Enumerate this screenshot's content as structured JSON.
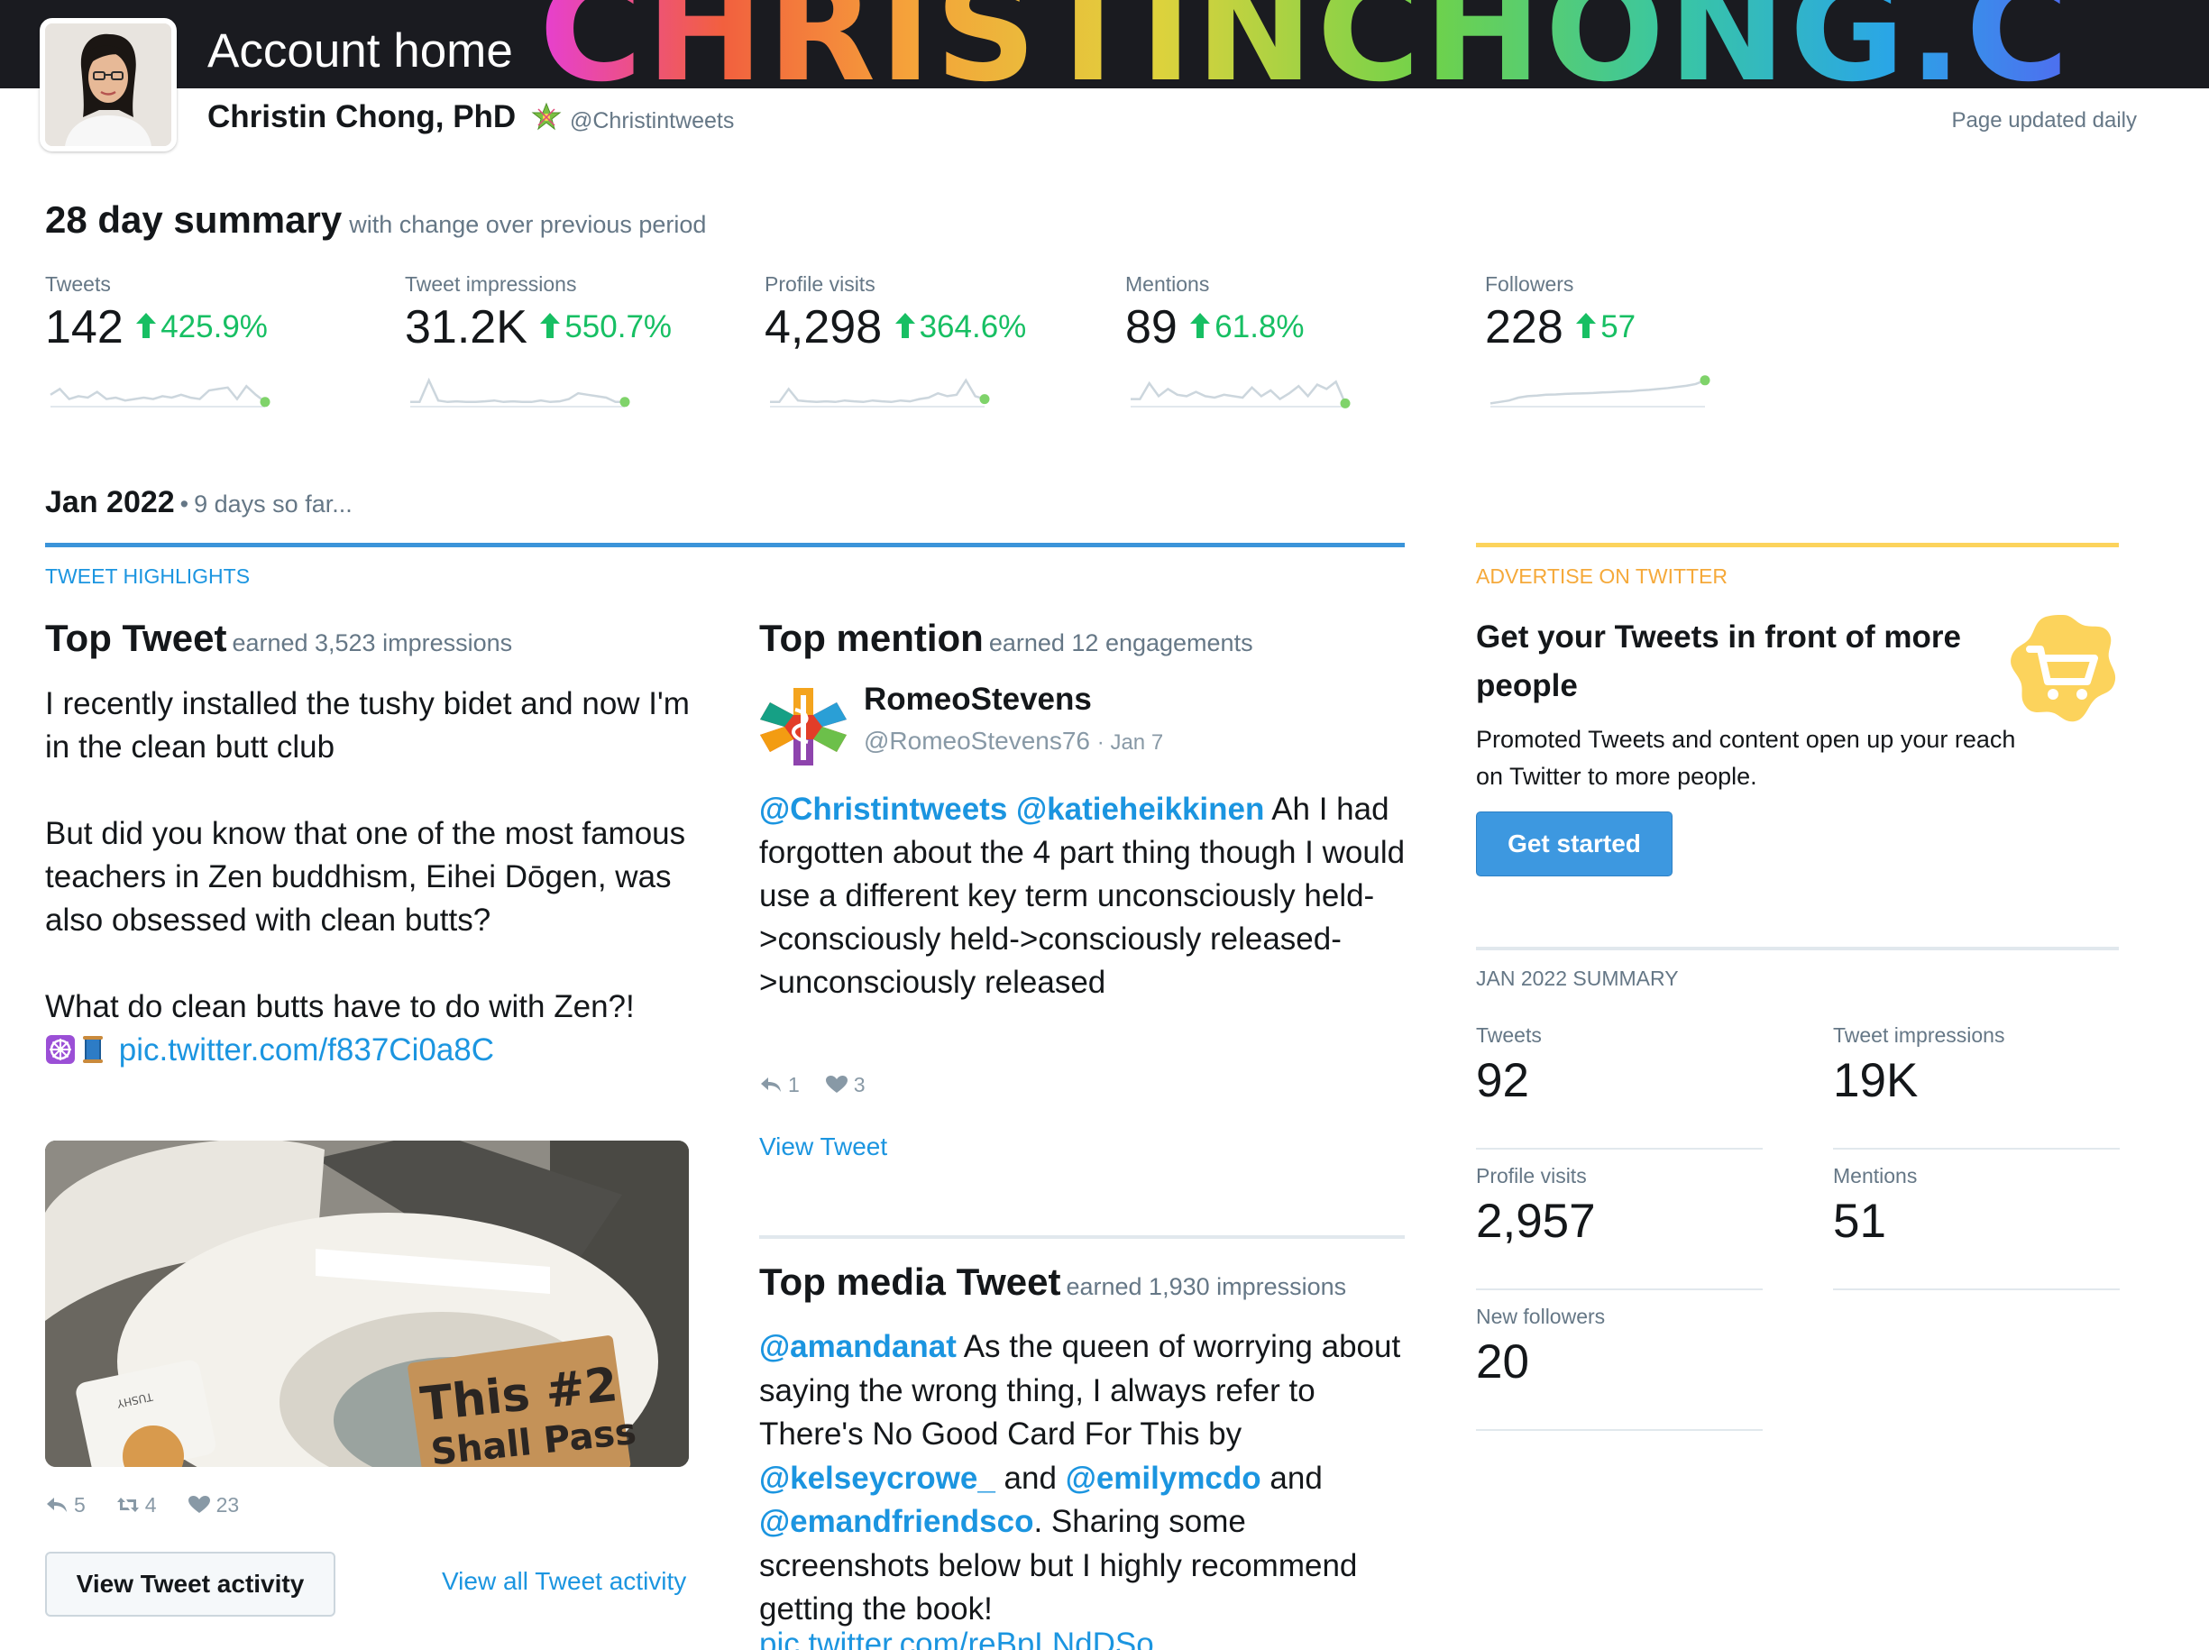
{
  "header": {
    "banner_text": "CHRISTINCHONG.C",
    "title": "Account home",
    "user_name": "Christin Chong, PhD",
    "handle": "@Christintweets",
    "page_updated": "Page updated daily"
  },
  "summary": {
    "title": "28 day summary",
    "subtitle": "with change over previous period",
    "metrics": [
      {
        "label": "Tweets",
        "value": "142",
        "change": "425.9%",
        "trend": [
          0.35,
          0.55,
          0.2,
          0.3,
          0.25,
          0.45,
          0.2,
          0.25,
          0.15,
          0.2,
          0.25,
          0.2,
          0.3,
          0.25,
          0.35,
          0.25,
          0.2,
          0.5,
          0.55,
          0.6,
          0.2,
          0.65,
          0.35,
          0.1
        ]
      },
      {
        "label": "Tweet impressions",
        "value": "31.2K",
        "change": "550.7%",
        "trend": [
          0.1,
          0.1,
          0.85,
          0.15,
          0.1,
          0.12,
          0.1,
          0.1,
          0.12,
          0.15,
          0.1,
          0.12,
          0.1,
          0.1,
          0.15,
          0.1,
          0.12,
          0.2,
          0.4,
          0.35,
          0.3,
          0.25,
          0.1,
          0.1
        ]
      },
      {
        "label": "Profile visits",
        "value": "4,298",
        "change": "364.6%",
        "trend": [
          0.1,
          0.1,
          0.55,
          0.15,
          0.12,
          0.1,
          0.12,
          0.1,
          0.15,
          0.12,
          0.1,
          0.15,
          0.12,
          0.1,
          0.15,
          0.12,
          0.2,
          0.25,
          0.4,
          0.3,
          0.35,
          0.85,
          0.3,
          0.2
        ]
      },
      {
        "label": "Mentions",
        "value": "89",
        "change": "61.8%",
        "trend": [
          0.2,
          0.2,
          0.75,
          0.3,
          0.55,
          0.35,
          0.3,
          0.45,
          0.3,
          0.25,
          0.35,
          0.3,
          0.25,
          0.6,
          0.3,
          0.5,
          0.2,
          0.4,
          0.65,
          0.3,
          0.7,
          0.55,
          0.8,
          0.05
        ]
      },
      {
        "label": "Followers",
        "value": "228",
        "change": "57",
        "trend": [
          0.05,
          0.1,
          0.15,
          0.25,
          0.3,
          0.32,
          0.35,
          0.36,
          0.38,
          0.39,
          0.4,
          0.41,
          0.43,
          0.44,
          0.46,
          0.47,
          0.5,
          0.52,
          0.55,
          0.58,
          0.62,
          0.66,
          0.72,
          0.85
        ]
      }
    ]
  },
  "period": {
    "title": "Jan 2022",
    "separator": "•",
    "subtitle": "9 days so far..."
  },
  "highlights": {
    "section_label": "TWEET HIGHLIGHTS",
    "top_tweet": {
      "title": "Top Tweet",
      "earned": "earned 3,523 impressions",
      "paragraph1": "I recently installed the tushy bidet and now I'm in the clean butt club",
      "paragraph2": "But did you know that one of the most famous teachers in Zen buddhism, Eihei Dōgen, was also obsessed with clean butts?",
      "paragraph3": "What do clean butts have to do with Zen?!",
      "link": "pic.twitter.com/f837Ci0a8C",
      "image_text_line1": "This #2",
      "image_text_line2": "Shall Pass",
      "image_brand": "TUSHY",
      "replies": "5",
      "retweets": "4",
      "likes": "23",
      "activity_button": "View Tweet activity",
      "all_activity_link": "View all Tweet activity"
    },
    "top_mention": {
      "title": "Top mention",
      "earned": "earned 12 engagements",
      "name": "RomeoStevens",
      "handle": "@RomeoStevens76",
      "date": "· Jan 7",
      "mention1": "@Christintweets",
      "mention2": "@katieheikkinen",
      "text": "Ah I had forgotten about the 4 part thing though I would use a different key term unconsciously held->consciously held->consciously released->unconsciously released",
      "replies": "1",
      "likes": "3",
      "view_link": "View Tweet"
    },
    "top_media": {
      "title": "Top media Tweet",
      "earned": "earned 1,930 impressions",
      "mention1": "@amandanat",
      "text1": "As the queen of worrying about saying the wrong thing, I always refer to There's No Good Card For This by",
      "mention2": "@kelseycrowe_",
      "and1": "and",
      "mention3": "@emilymcdo",
      "and2": "and",
      "mention4": "@emandfriendsco",
      "text2": ". Sharing some screenshots below but I highly recommend getting the book!",
      "link": "pic.twitter.com/reBpLNdDSo"
    }
  },
  "advertise": {
    "section_label": "ADVERTISE ON TWITTER",
    "title": "Get your Tweets in front of more people",
    "text": "Promoted Tweets and content open up your reach on Twitter to more people.",
    "button": "Get started"
  },
  "jan_summary": {
    "label": "JAN 2022 SUMMARY",
    "stats": [
      {
        "label": "Tweets",
        "value": "92"
      },
      {
        "label": "Tweet impressions",
        "value": "19K"
      },
      {
        "label": "Profile visits",
        "value": "2,957"
      },
      {
        "label": "Mentions",
        "value": "51"
      },
      {
        "label": "New followers",
        "value": "20"
      }
    ]
  },
  "colors": {
    "accent_blue": "#1b95e0",
    "positive_green": "#17bf63",
    "advertise_yellow": "#fcd35c",
    "sparkline_grey": "#ccd6dd",
    "sparkline_dot": "#7fd36a"
  }
}
